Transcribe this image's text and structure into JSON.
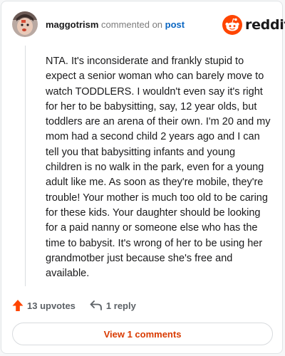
{
  "header": {
    "username": "maggotrism",
    "action_text": "commented on",
    "post_link": "post"
  },
  "brand": {
    "name": "reddit",
    "accent": "#ff4500"
  },
  "comment": {
    "body": "NTA. It's inconsiderate and frankly stupid to expect a senior woman who can barely move to watch TODDLERS. I wouldn't even say it's right for her to be babysitting, say, 12 year olds, but toddlers are an arena of their own. I'm 20 and my mom had a second child 2 years ago and I can tell you that babysitting infants and young children is no walk in the park, even for a young adult like me. As soon as they're mobile, they're trouble! Your mother is much too old to be caring for these kids. Your daughter should be looking for a paid nanny or someone else who has the time to babysit. It's wrong of her to be using her grandmotber just because she's free and available."
  },
  "actions": {
    "upvotes": "13 upvotes",
    "replies": "1 reply",
    "upvote_icon": "up-arrow-icon",
    "reply_icon": "reply-arrow-icon"
  },
  "footer": {
    "view_comments": "View 1 comments"
  },
  "colors": {
    "upvote": "#ff4500",
    "view_button_text": "#d93a00",
    "link": "#0a66c2"
  }
}
